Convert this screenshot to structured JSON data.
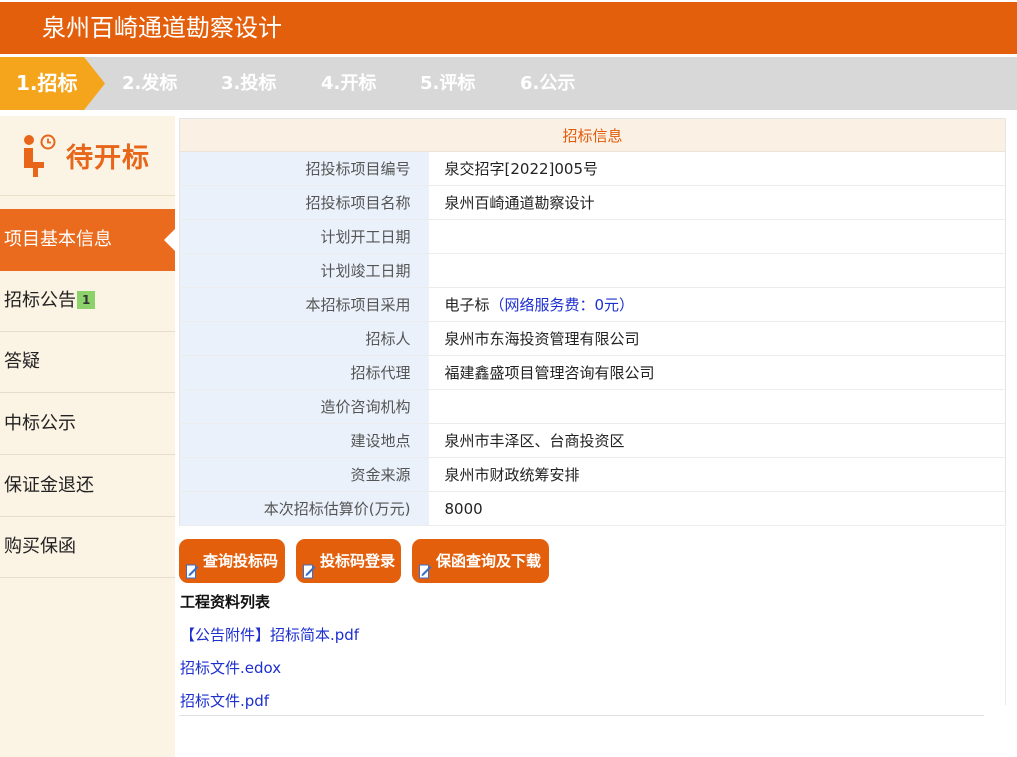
{
  "header": {
    "title": "泉州百崎通道勘察设计"
  },
  "steps": [
    {
      "label": "1.招标"
    },
    {
      "label": "2.发标"
    },
    {
      "label": "3.投标"
    },
    {
      "label": "4.开标"
    },
    {
      "label": "5.评标"
    },
    {
      "label": "6.公示"
    }
  ],
  "sidebar": {
    "status": "待开标",
    "status_icon": "waiting-person-clock-icon",
    "items": [
      {
        "label": "项目基本信息"
      },
      {
        "label": "招标公告",
        "badge": "1"
      },
      {
        "label": "答疑"
      },
      {
        "label": "中标公示"
      },
      {
        "label": "保证金退还"
      },
      {
        "label": "购买保函"
      }
    ]
  },
  "info": {
    "caption": "招标信息",
    "rows": [
      {
        "label": "招投标项目编号",
        "value": "泉交招字[2022]005号"
      },
      {
        "label": "招投标项目名称",
        "value": "泉州百崎通道勘察设计"
      },
      {
        "label": "计划开工日期",
        "value": ""
      },
      {
        "label": "计划竣工日期",
        "value": ""
      },
      {
        "label": "本招标项目采用",
        "value": "电子标",
        "note": "（网络服务费：0元）"
      },
      {
        "label": "招标人",
        "value": "泉州市东海投资管理有限公司"
      },
      {
        "label": "招标代理",
        "value": "福建鑫盛项目管理咨询有限公司"
      },
      {
        "label": "造价咨询机构",
        "value": ""
      },
      {
        "label": "建设地点",
        "value": "泉州市丰泽区、台商投资区"
      },
      {
        "label": "资金来源",
        "value": "泉州市财政统筹安排"
      },
      {
        "label": "本次招标估算价(万元)",
        "value": "8000"
      }
    ]
  },
  "buttons": {
    "query_code": "查询投标码",
    "code_login": "投标码登录",
    "guarantee": "保函查询及下载"
  },
  "files": {
    "title": "工程资料列表",
    "items": [
      {
        "label": "【公告附件】招标简本.pdf"
      },
      {
        "label": "招标文件.edox"
      },
      {
        "label": "招标文件.pdf"
      }
    ]
  },
  "colors": {
    "brand_orange": "#e35f0c",
    "step_active": "#f4a51c",
    "sidebar_bg": "#fbf3e4",
    "link_blue": "#1d2fcf",
    "badge_green": "#8bd26b"
  }
}
